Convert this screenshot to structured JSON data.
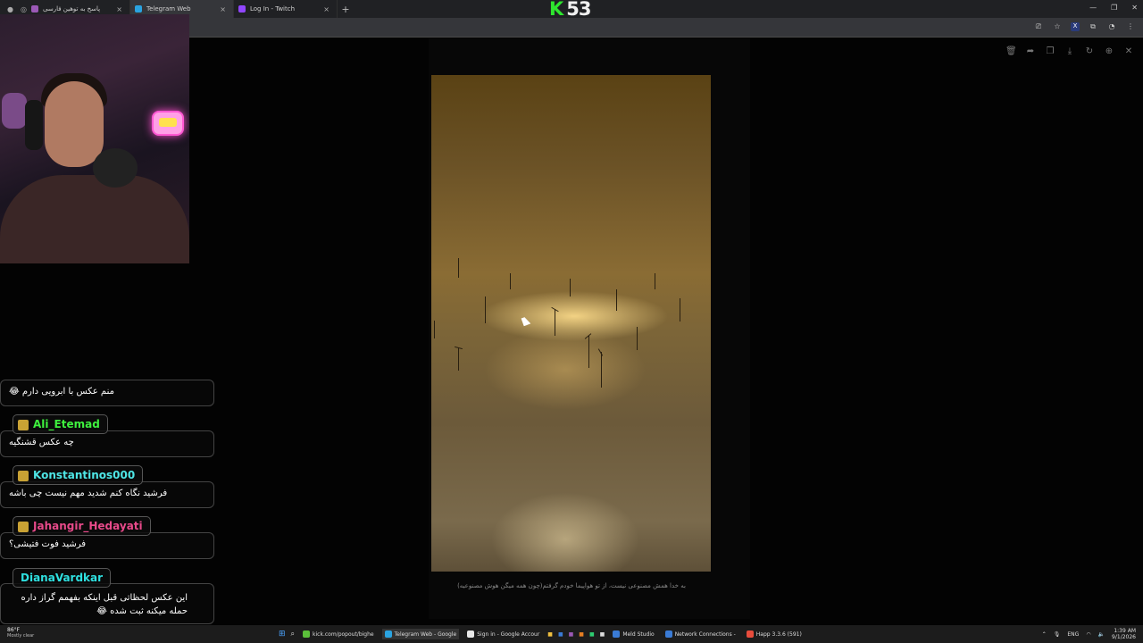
{
  "browser": {
    "tabs": [
      {
        "title": "پاسخ به توهین فارسی",
        "fav_color": "#9b59b6",
        "active": false
      },
      {
        "title": "Telegram Web",
        "fav_color": "#2aa3e0",
        "active": true
      },
      {
        "title": "Log In - Twitch",
        "fav_color": "#9146ff",
        "active": false
      }
    ],
    "new_tab_label": "+",
    "close_label": "×"
  },
  "counter": {
    "letter": "K",
    "number": "53"
  },
  "viewer": {
    "tools": [
      "delete-icon",
      "forward-icon",
      "copy-icon",
      "download-icon",
      "rotate-icon",
      "zoom-icon",
      "close-icon"
    ],
    "caption": "به خدا همش مصنوعی نیست، از تو هواپیما خودم گرفتم(چون همه میگن هوش مصنوعیه)"
  },
  "chat": {
    "messages": [
      {
        "user": "",
        "text": "منم عکس با ابرویی دارم 😂"
      },
      {
        "user": "Ali_Etemad",
        "user_color": "#3ef03e",
        "text": "چه عکس قشنگیه"
      },
      {
        "user": "Konstantinos000",
        "user_color": "#4ee6e6",
        "text": "فرشید نگاه کنم شدید مهم نیست چی باشه"
      },
      {
        "user": "Jahangir_Hedayati",
        "user_color": "#e84a8a",
        "text": "فرشید فوت فتیشی؟"
      },
      {
        "user": "DianaVardkar",
        "user_color": "#2ee0e0",
        "text": "این عکس لحظاتی قبل اینکه بفهمم گراز داره حمله میکنه ثبت شده 😂"
      }
    ]
  },
  "taskbar": {
    "weather_temp": "86°F",
    "weather_cond": "Mostly clear",
    "items": [
      {
        "label": "kick.com/popout/bighe",
        "color": "#5bbf3a"
      },
      {
        "label": "Telegram Web - Google",
        "color": "#2aa3e0"
      },
      {
        "label": "Sign in - Google Accour",
        "color": "#e8e8e8"
      },
      {
        "label": "Meld Studio",
        "color": "#3a7bd5"
      },
      {
        "label": "Network Connections -",
        "color": "#3a7bd5"
      },
      {
        "label": "Happ 3.3.6 (591)",
        "color": "#e74c3c"
      }
    ],
    "lang": "ENG",
    "time": "1:39 AM",
    "date": "9/1/2026"
  }
}
